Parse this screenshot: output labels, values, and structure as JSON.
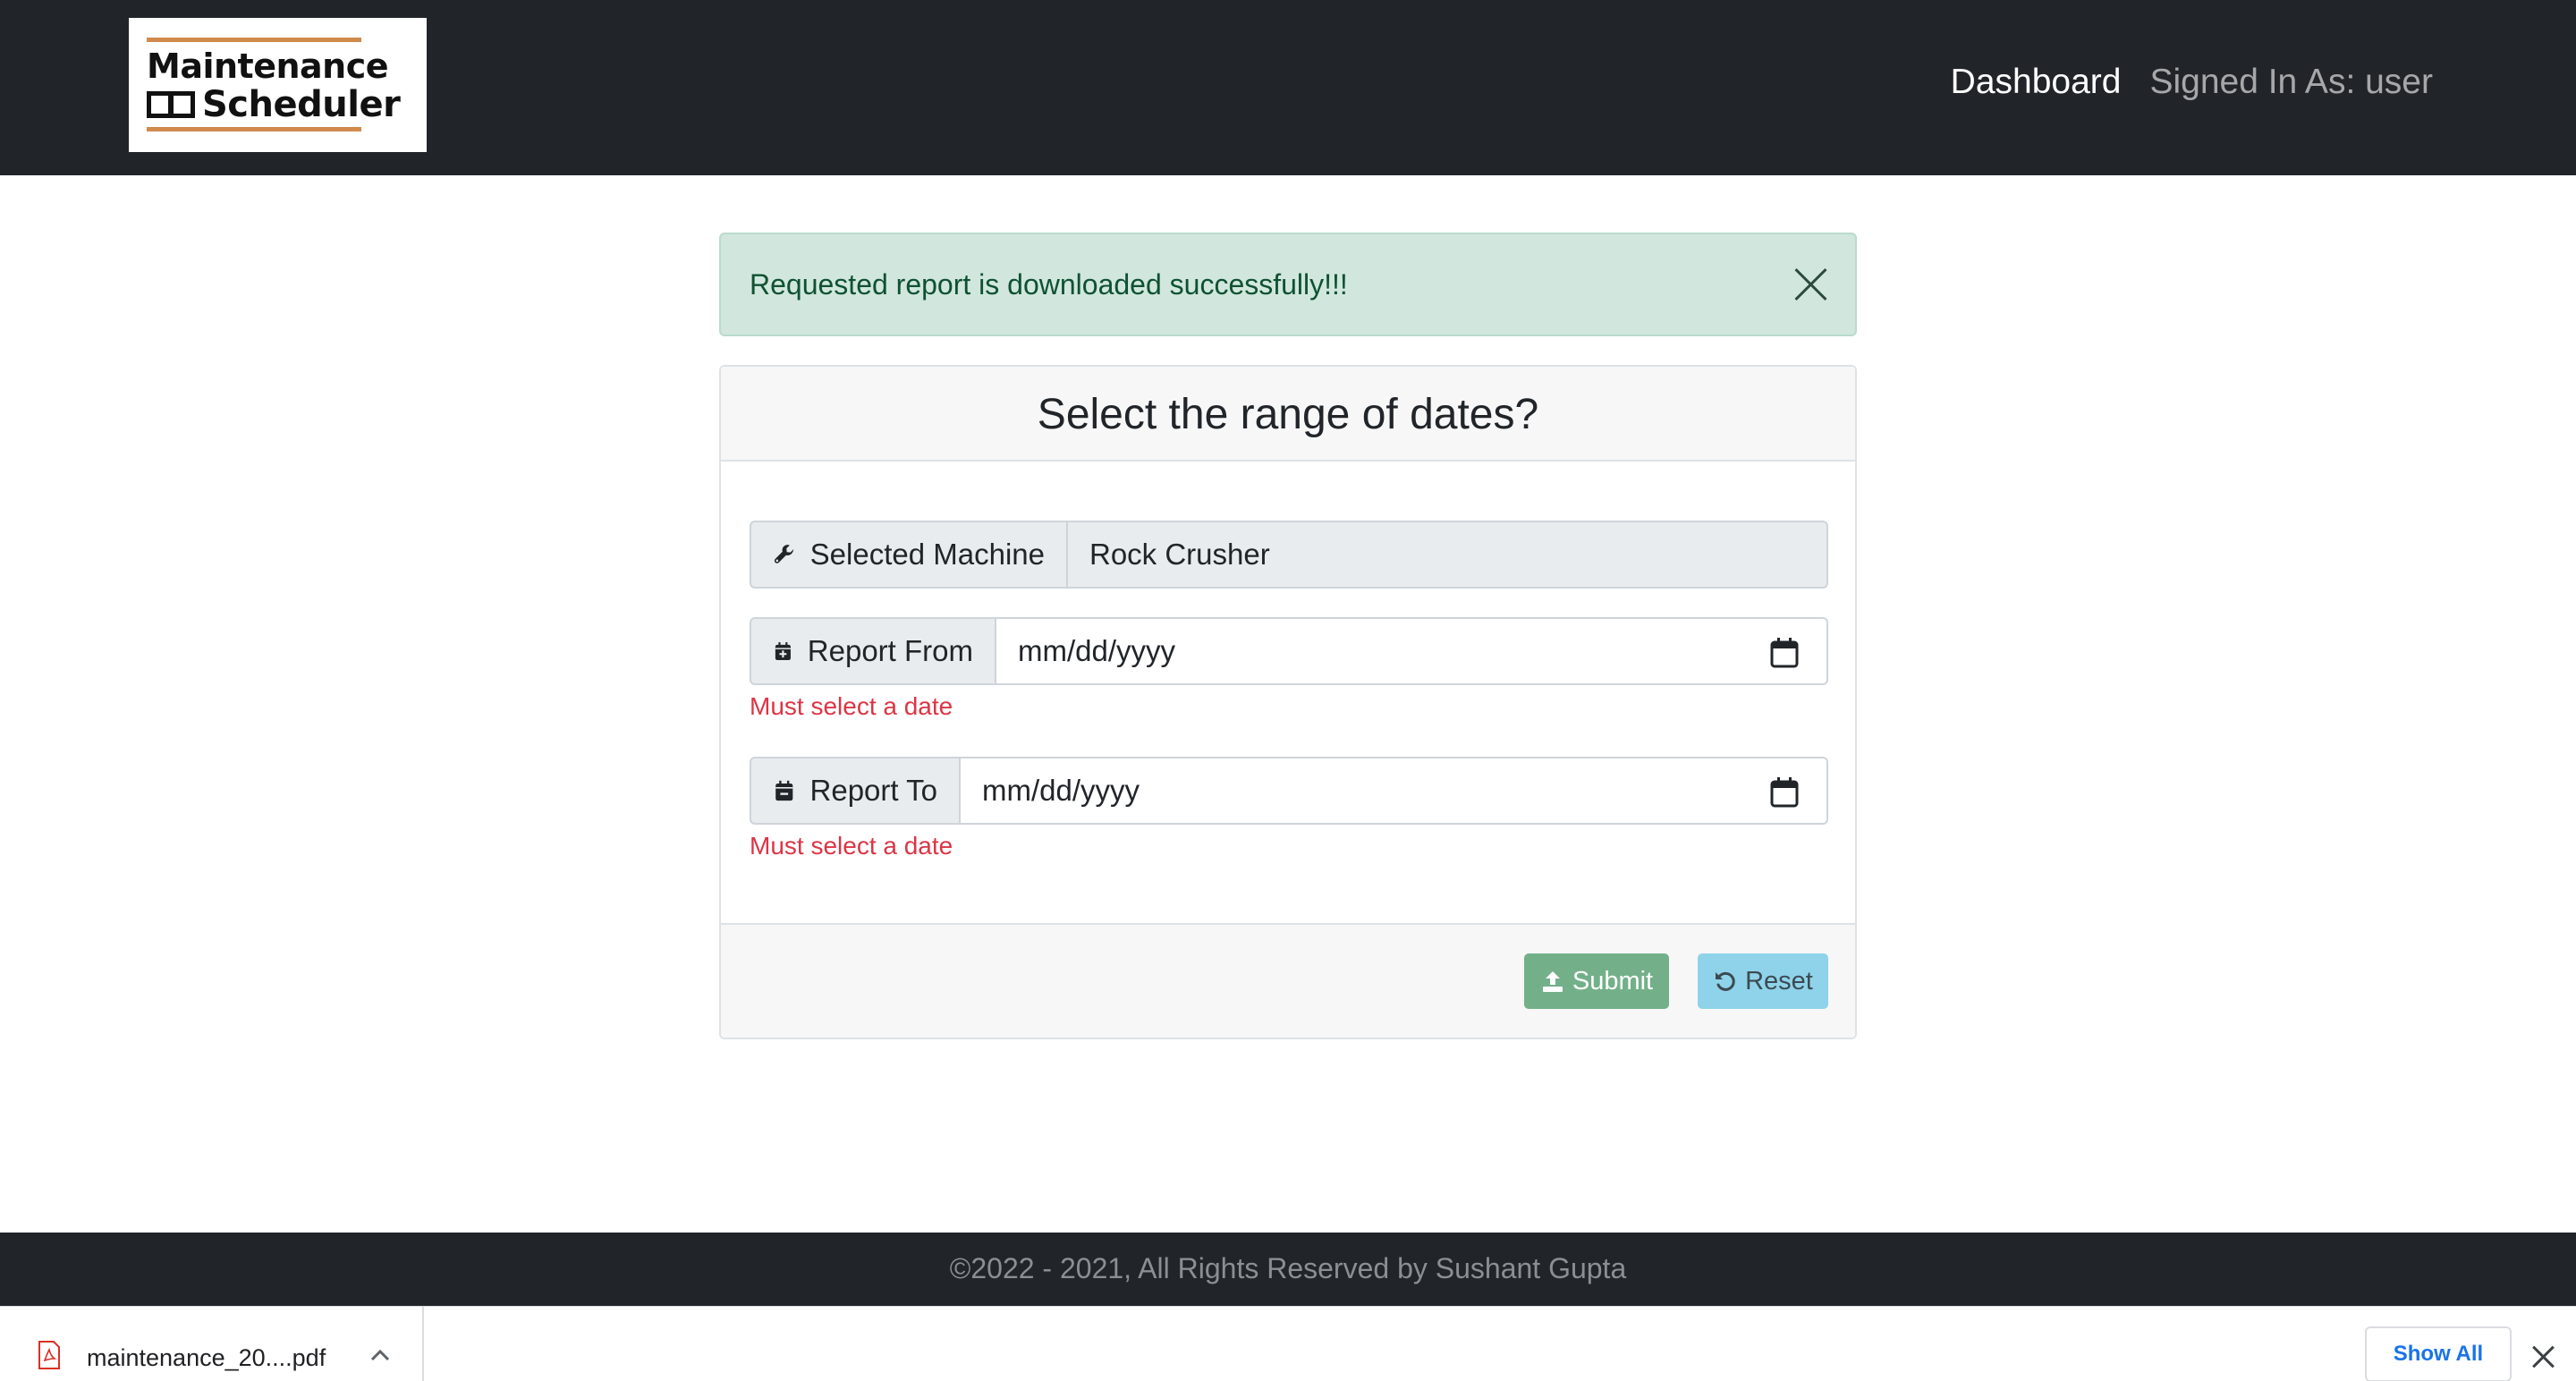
{
  "navbar": {
    "logo_line1": "Maintenance",
    "logo_line2": "Scheduler",
    "dashboard_link": "Dashboard",
    "signed_in_text": "Signed In As: user"
  },
  "alert": {
    "message": "Requested report is downloaded successfully!!!"
  },
  "card": {
    "title": "Select the range of dates?",
    "machine_label": "Selected Machine",
    "machine_value": "Rock Crusher",
    "from_label": "Report From",
    "from_placeholder": "mm/dd/yyyy",
    "from_error": "Must select a date",
    "to_label": "Report To",
    "to_placeholder": "mm/dd/yyyy",
    "to_error": "Must select a date",
    "submit_label": "Submit",
    "reset_label": "Reset"
  },
  "footer": {
    "text": "©2022 - 2021, All Rights Reserved by Sushant Gupta"
  },
  "download_bar": {
    "file_name": "maintenance_20....pdf",
    "show_all_label": "Show All"
  },
  "colors": {
    "navbar_bg": "#212529",
    "alert_bg": "#d1e7dd",
    "error": "#dc3545",
    "submit_bg": "#73b08a",
    "reset_bg": "#8fd3ea",
    "logo_accent": "#d08a4c"
  },
  "icons": {
    "machine": "wrench-icon",
    "from": "calendar-plus-icon",
    "to": "calendar-minus-icon",
    "date_picker": "calendar-icon",
    "submit": "upload-icon",
    "reset": "undo-icon",
    "alert_close": "close-icon",
    "download_file": "pdf-icon",
    "download_menu": "chevron-up-icon",
    "download_close": "close-icon"
  }
}
